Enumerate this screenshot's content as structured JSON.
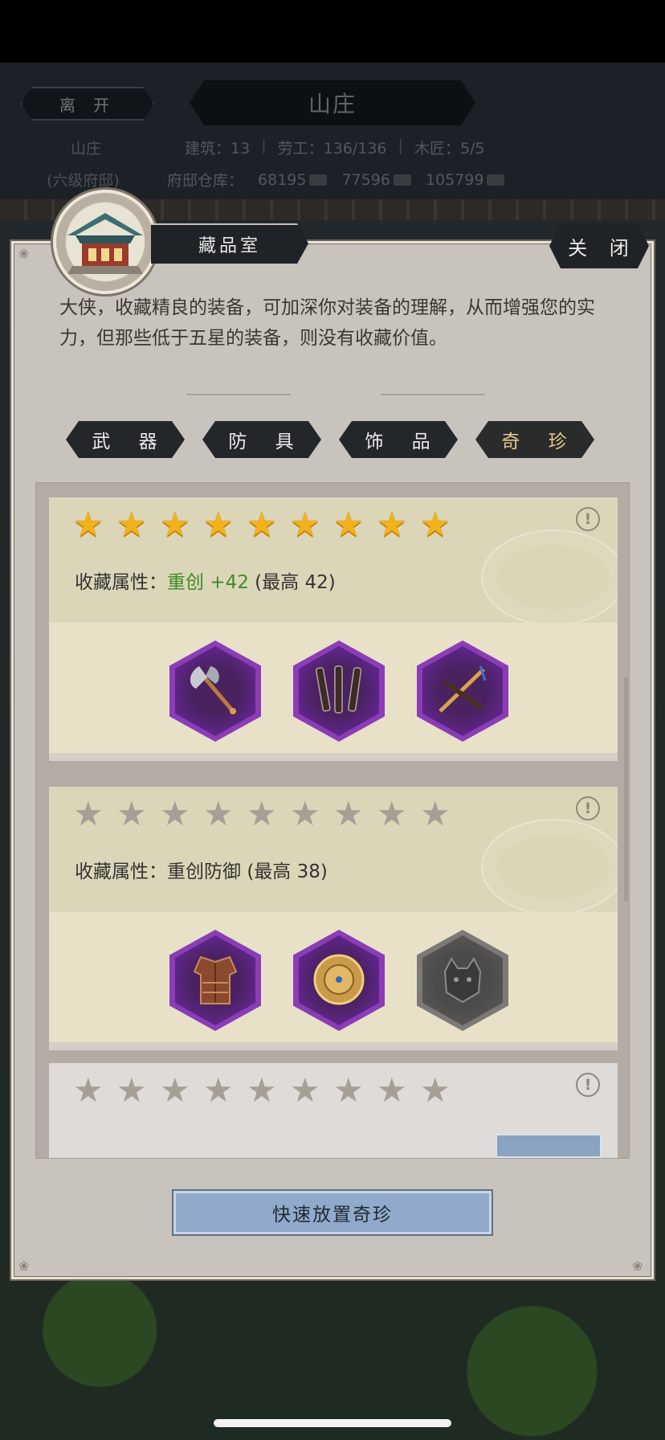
{
  "header": {
    "leave_label": "离 开",
    "title": "山庄",
    "estate_name": "山庄",
    "estate_level": "(六级府邸)",
    "stats": [
      {
        "label": "建筑：13"
      },
      {
        "label": "劳工：136/136"
      },
      {
        "label": "木匠：5/5"
      }
    ],
    "storehouse_label": "府邸仓库：",
    "resources": [
      {
        "value": "68195",
        "icon": "wood-icon"
      },
      {
        "value": "77596",
        "icon": "iron-icon"
      },
      {
        "value": "105799",
        "icon": "stone-icon"
      }
    ]
  },
  "dialog": {
    "title": "藏品室",
    "close_label": "关 闭",
    "description": "大侠，收藏精良的装备，可加深你对装备的理解，从而增强您的实力，但那些低于五星的装备，则没有收藏价值。",
    "tabs": [
      {
        "label": "武 器",
        "active": false
      },
      {
        "label": "防 具",
        "active": false
      },
      {
        "label": "饰 品",
        "active": false
      },
      {
        "label": "奇 珍",
        "active": true
      }
    ]
  },
  "collections": [
    {
      "stars_filled": 9,
      "stars_total": 9,
      "attr_prefix": "收藏属性：",
      "attr_name": "重创 +42",
      "attr_max": "(最高 42)",
      "items": [
        {
          "name": "axe-icon",
          "rarity": "purple"
        },
        {
          "name": "nunchaku-icon",
          "rarity": "purple"
        },
        {
          "name": "crossed-swords-icon",
          "rarity": "purple"
        }
      ]
    },
    {
      "stars_filled": 0,
      "stars_total": 9,
      "attr_prefix": "收藏属性：",
      "attr_name": "重创防御",
      "attr_max": "(最高 38)",
      "items": [
        {
          "name": "armor-icon",
          "rarity": "purple"
        },
        {
          "name": "medallion-icon",
          "rarity": "purple"
        },
        {
          "name": "beast-helmet-icon",
          "rarity": "grey"
        }
      ]
    },
    {
      "stars_filled": 0,
      "stars_total": 9
    }
  ],
  "footer": {
    "quick_place_label": "快速放置奇珍"
  },
  "colors": {
    "accent_gold": "#f2b21b",
    "rarity_purple": "#8b3db8",
    "attr_green": "#3e8a25",
    "button_blue": "#91aacb"
  }
}
